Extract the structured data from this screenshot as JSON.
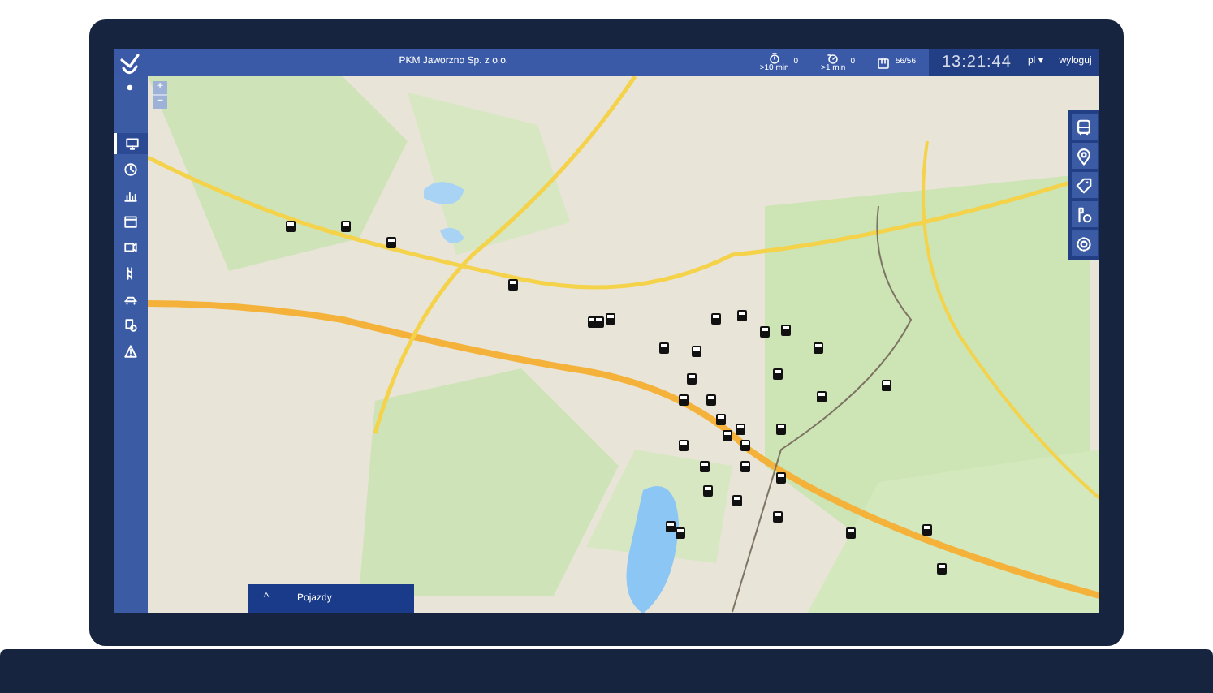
{
  "top_bar": {
    "title": "PKM Jaworzno Sp. z o.o.",
    "stats": [
      {
        "value": "0",
        "caption": ">10 min"
      },
      {
        "value": "0",
        "caption": ">1 min"
      },
      {
        "value": "56/56"
      }
    ],
    "clock": "13:21:44",
    "language": "pl",
    "language_caret": "▾",
    "logout": "wyloguj"
  },
  "sidebar": {
    "items": [
      {
        "selected": true
      },
      {
        "selected": false
      },
      {
        "selected": false
      },
      {
        "selected": false
      },
      {
        "selected": false
      },
      {
        "selected": false
      },
      {
        "selected": false
      },
      {
        "selected": false
      },
      {
        "selected": false
      }
    ]
  },
  "map": {
    "zoom_in": "+",
    "zoom_out": "−"
  },
  "bottom_panel": {
    "toggle": "^",
    "title": "Pojazdy"
  }
}
